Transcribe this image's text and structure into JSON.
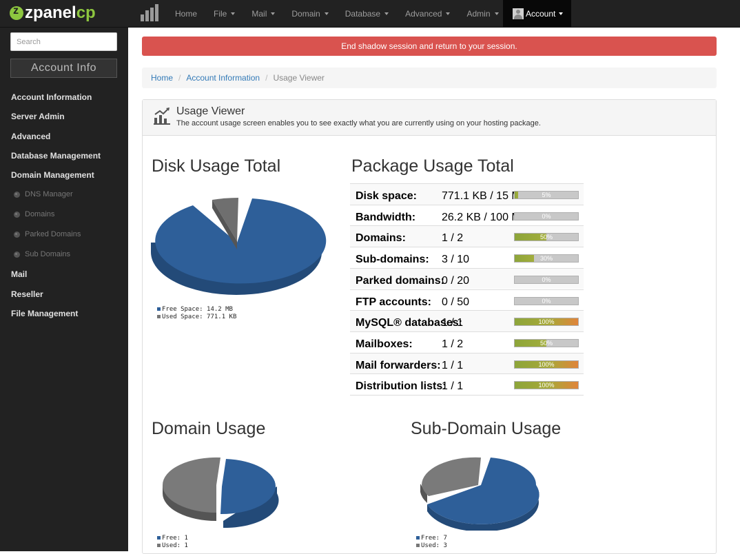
{
  "app": {
    "logo_left": "zpanel",
    "logo_right": "cp"
  },
  "nav": {
    "items": [
      "Home",
      "File",
      "Mail",
      "Domain",
      "Database",
      "Advanced",
      "Admin"
    ],
    "account": "Account"
  },
  "sidebar": {
    "search_placeholder": "Search",
    "account_info": "Account Info",
    "menu": [
      "Account Information",
      "Server Admin",
      "Advanced",
      "Database Management",
      "Domain Management"
    ],
    "sub_menu": [
      "DNS Manager",
      "Domains",
      "Parked Domains",
      "Sub Domains"
    ],
    "menu_after": [
      "Mail",
      "Reseller",
      "File Management"
    ]
  },
  "alert": "End shadow session and return to your session.",
  "breadcrumb": {
    "home": "Home",
    "account_info": "Account Information",
    "current": "Usage Viewer"
  },
  "panel": {
    "title": "Usage Viewer",
    "description": "The account usage screen enables you to see exactly what you are currently using on your hosting package."
  },
  "disk": {
    "title": "Disk Usage Total",
    "legend": [
      "Free Space: 14.2 MB",
      "Used Space: 771.1 KB"
    ],
    "free_fraction": 0.95,
    "used_fraction": 0.05
  },
  "package": {
    "title": "Package Usage Total",
    "rows": [
      {
        "label": "Disk space:",
        "value": "771.1 KB / 15 MB",
        "percent": "5%",
        "pct": 5
      },
      {
        "label": "Bandwidth:",
        "value": "26.2 KB / 100 MB",
        "percent": "0%",
        "pct": 0
      },
      {
        "label": "Domains:",
        "value": "1 / 2",
        "percent": "50%",
        "pct": 50
      },
      {
        "label": "Sub-domains:",
        "value": "3 / 10",
        "percent": "30%",
        "pct": 30
      },
      {
        "label": "Parked domains:",
        "value": "0 / 20",
        "percent": "0%",
        "pct": 0
      },
      {
        "label": "FTP accounts:",
        "value": "0 / 50",
        "percent": "0%",
        "pct": 0
      },
      {
        "label": "MySQL® databases:",
        "value": "1 / 1",
        "percent": "100%",
        "pct": 100
      },
      {
        "label": "Mailboxes:",
        "value": "1 / 2",
        "percent": "50%",
        "pct": 50
      },
      {
        "label": "Mail forwarders:",
        "value": "1 / 1",
        "percent": "100%",
        "pct": 100
      },
      {
        "label": "Distribution lists:",
        "value": "1 / 1",
        "percent": "100%",
        "pct": 100
      }
    ]
  },
  "domain": {
    "title": "Domain Usage",
    "legend": [
      "Free: 1",
      "Used: 1"
    ],
    "free_fraction": 0.5
  },
  "subdomain": {
    "title": "Sub-Domain Usage",
    "legend": [
      "Free: 7",
      "Used: 3"
    ],
    "free_fraction": 0.7
  },
  "colors": {
    "free": "#2e5f99",
    "used": "#777777",
    "alert": "#d9534f",
    "bar_green": "#8da53a",
    "bar_orange": "#e0843a"
  }
}
